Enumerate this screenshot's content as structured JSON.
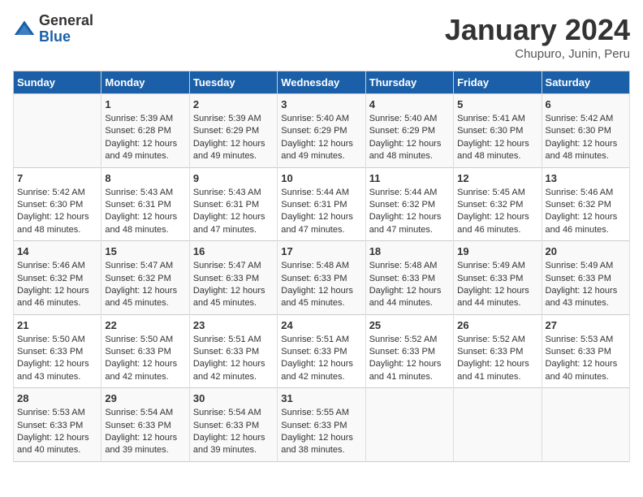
{
  "header": {
    "logo_general": "General",
    "logo_blue": "Blue",
    "month_title": "January 2024",
    "location": "Chupuro, Junin, Peru"
  },
  "days_of_week": [
    "Sunday",
    "Monday",
    "Tuesday",
    "Wednesday",
    "Thursday",
    "Friday",
    "Saturday"
  ],
  "weeks": [
    [
      {
        "day": "",
        "text": ""
      },
      {
        "day": "1",
        "text": "Sunrise: 5:39 AM\nSunset: 6:28 PM\nDaylight: 12 hours\nand 49 minutes."
      },
      {
        "day": "2",
        "text": "Sunrise: 5:39 AM\nSunset: 6:29 PM\nDaylight: 12 hours\nand 49 minutes."
      },
      {
        "day": "3",
        "text": "Sunrise: 5:40 AM\nSunset: 6:29 PM\nDaylight: 12 hours\nand 49 minutes."
      },
      {
        "day": "4",
        "text": "Sunrise: 5:40 AM\nSunset: 6:29 PM\nDaylight: 12 hours\nand 48 minutes."
      },
      {
        "day": "5",
        "text": "Sunrise: 5:41 AM\nSunset: 6:30 PM\nDaylight: 12 hours\nand 48 minutes."
      },
      {
        "day": "6",
        "text": "Sunrise: 5:42 AM\nSunset: 6:30 PM\nDaylight: 12 hours\nand 48 minutes."
      }
    ],
    [
      {
        "day": "7",
        "text": "Sunrise: 5:42 AM\nSunset: 6:30 PM\nDaylight: 12 hours\nand 48 minutes."
      },
      {
        "day": "8",
        "text": "Sunrise: 5:43 AM\nSunset: 6:31 PM\nDaylight: 12 hours\nand 48 minutes."
      },
      {
        "day": "9",
        "text": "Sunrise: 5:43 AM\nSunset: 6:31 PM\nDaylight: 12 hours\nand 47 minutes."
      },
      {
        "day": "10",
        "text": "Sunrise: 5:44 AM\nSunset: 6:31 PM\nDaylight: 12 hours\nand 47 minutes."
      },
      {
        "day": "11",
        "text": "Sunrise: 5:44 AM\nSunset: 6:32 PM\nDaylight: 12 hours\nand 47 minutes."
      },
      {
        "day": "12",
        "text": "Sunrise: 5:45 AM\nSunset: 6:32 PM\nDaylight: 12 hours\nand 46 minutes."
      },
      {
        "day": "13",
        "text": "Sunrise: 5:46 AM\nSunset: 6:32 PM\nDaylight: 12 hours\nand 46 minutes."
      }
    ],
    [
      {
        "day": "14",
        "text": "Sunrise: 5:46 AM\nSunset: 6:32 PM\nDaylight: 12 hours\nand 46 minutes."
      },
      {
        "day": "15",
        "text": "Sunrise: 5:47 AM\nSunset: 6:32 PM\nDaylight: 12 hours\nand 45 minutes."
      },
      {
        "day": "16",
        "text": "Sunrise: 5:47 AM\nSunset: 6:33 PM\nDaylight: 12 hours\nand 45 minutes."
      },
      {
        "day": "17",
        "text": "Sunrise: 5:48 AM\nSunset: 6:33 PM\nDaylight: 12 hours\nand 45 minutes."
      },
      {
        "day": "18",
        "text": "Sunrise: 5:48 AM\nSunset: 6:33 PM\nDaylight: 12 hours\nand 44 minutes."
      },
      {
        "day": "19",
        "text": "Sunrise: 5:49 AM\nSunset: 6:33 PM\nDaylight: 12 hours\nand 44 minutes."
      },
      {
        "day": "20",
        "text": "Sunrise: 5:49 AM\nSunset: 6:33 PM\nDaylight: 12 hours\nand 43 minutes."
      }
    ],
    [
      {
        "day": "21",
        "text": "Sunrise: 5:50 AM\nSunset: 6:33 PM\nDaylight: 12 hours\nand 43 minutes."
      },
      {
        "day": "22",
        "text": "Sunrise: 5:50 AM\nSunset: 6:33 PM\nDaylight: 12 hours\nand 42 minutes."
      },
      {
        "day": "23",
        "text": "Sunrise: 5:51 AM\nSunset: 6:33 PM\nDaylight: 12 hours\nand 42 minutes."
      },
      {
        "day": "24",
        "text": "Sunrise: 5:51 AM\nSunset: 6:33 PM\nDaylight: 12 hours\nand 42 minutes."
      },
      {
        "day": "25",
        "text": "Sunrise: 5:52 AM\nSunset: 6:33 PM\nDaylight: 12 hours\nand 41 minutes."
      },
      {
        "day": "26",
        "text": "Sunrise: 5:52 AM\nSunset: 6:33 PM\nDaylight: 12 hours\nand 41 minutes."
      },
      {
        "day": "27",
        "text": "Sunrise: 5:53 AM\nSunset: 6:33 PM\nDaylight: 12 hours\nand 40 minutes."
      }
    ],
    [
      {
        "day": "28",
        "text": "Sunrise: 5:53 AM\nSunset: 6:33 PM\nDaylight: 12 hours\nand 40 minutes."
      },
      {
        "day": "29",
        "text": "Sunrise: 5:54 AM\nSunset: 6:33 PM\nDaylight: 12 hours\nand 39 minutes."
      },
      {
        "day": "30",
        "text": "Sunrise: 5:54 AM\nSunset: 6:33 PM\nDaylight: 12 hours\nand 39 minutes."
      },
      {
        "day": "31",
        "text": "Sunrise: 5:55 AM\nSunset: 6:33 PM\nDaylight: 12 hours\nand 38 minutes."
      },
      {
        "day": "",
        "text": ""
      },
      {
        "day": "",
        "text": ""
      },
      {
        "day": "",
        "text": ""
      }
    ]
  ]
}
